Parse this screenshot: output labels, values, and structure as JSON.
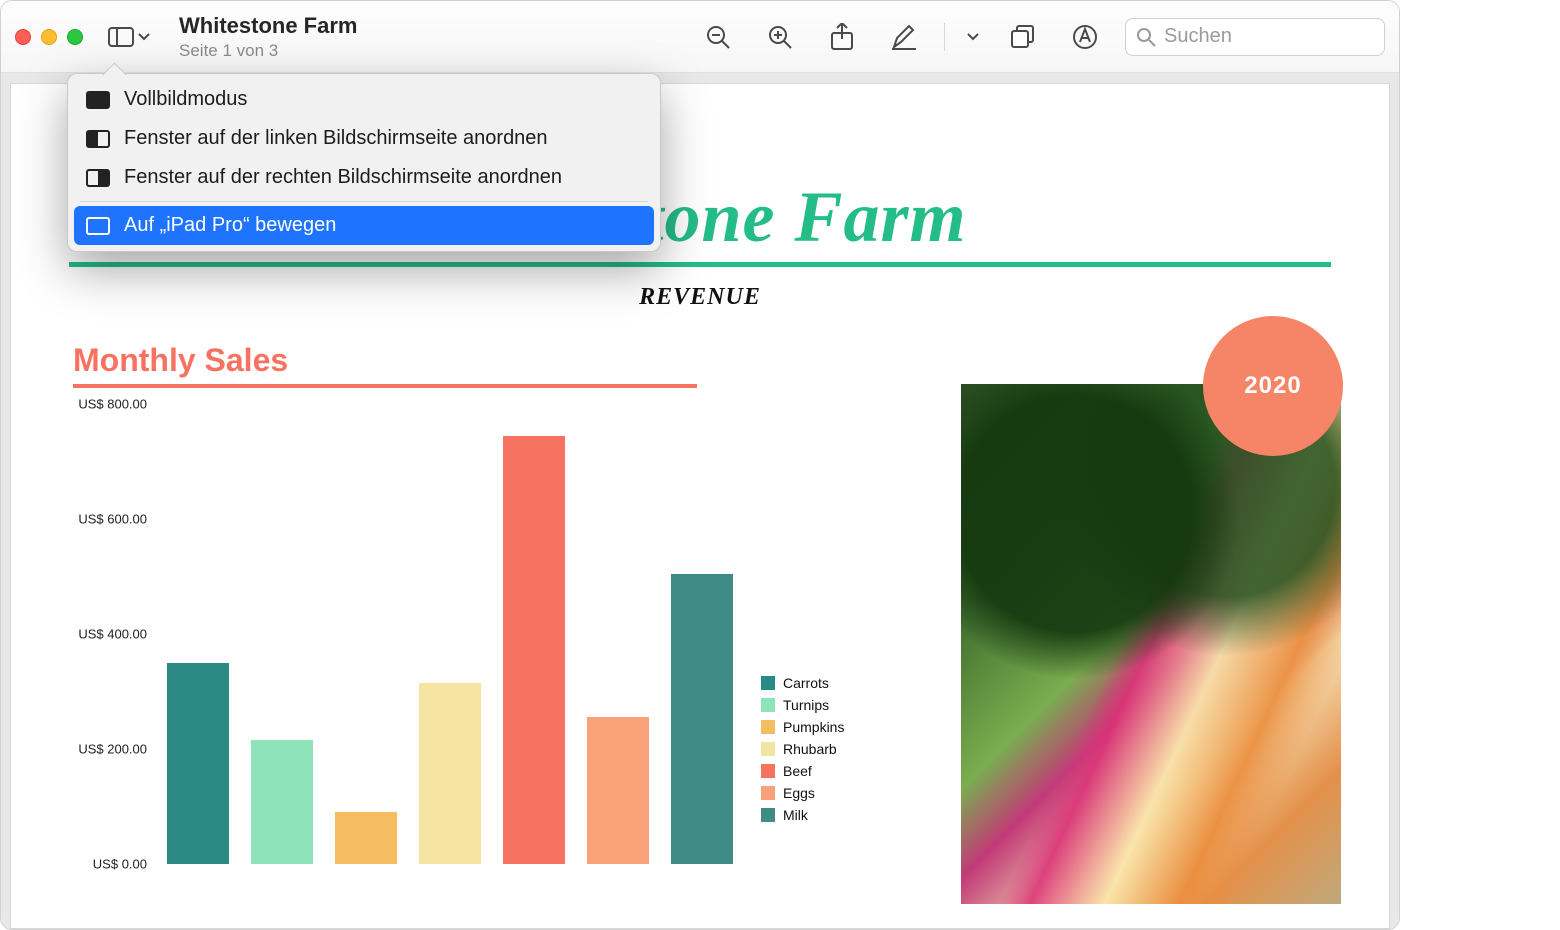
{
  "toolbar": {
    "title": "Whitestone Farm",
    "subtitle": "Seite 1 von 3",
    "search_placeholder": "Suchen"
  },
  "menu": {
    "items": [
      {
        "label": "Vollbildmodus"
      },
      {
        "label": "Fenster auf der linken Bildschirmseite anordnen"
      },
      {
        "label": "Fenster auf der rechten Bildschirmseite anordnen"
      }
    ],
    "selected_label": "Auf „iPad Pro“ bewegen"
  },
  "document": {
    "hero_title": "Whitestone Farm",
    "revenue_label": "REVENUE",
    "chart_title": "Monthly Sales",
    "year_badge": "2020"
  },
  "legend": [
    {
      "name": "Carrots",
      "color": "#2b8a83"
    },
    {
      "name": "Turnips",
      "color": "#8ee3b8"
    },
    {
      "name": "Pumpkins",
      "color": "#f6bd60"
    },
    {
      "name": "Rhubarb",
      "color": "#f4e3a1"
    },
    {
      "name": "Beef",
      "color": "#f87261"
    },
    {
      "name": "Eggs",
      "color": "#f9a27a"
    },
    {
      "name": "Milk",
      "color": "#3f8c86"
    }
  ],
  "chart_data": {
    "type": "bar",
    "title": "Monthly Sales",
    "ylabel": "US$",
    "ylim": [
      0,
      800
    ],
    "y_ticks": [
      "US$ 800.00",
      "US$ 600.00",
      "US$ 400.00",
      "US$ 200.00",
      "US$ 0.00"
    ],
    "categories": [
      "Carrots",
      "Turnips",
      "Pumpkins",
      "Rhubarb",
      "Beef",
      "Eggs",
      "Milk"
    ],
    "values": [
      350,
      215,
      90,
      315,
      745,
      255,
      505
    ],
    "colors": [
      "#2b8a83",
      "#8ee3b8",
      "#f6bd60",
      "#f4e3a1",
      "#f87261",
      "#f9a27a",
      "#3f8c86"
    ]
  }
}
